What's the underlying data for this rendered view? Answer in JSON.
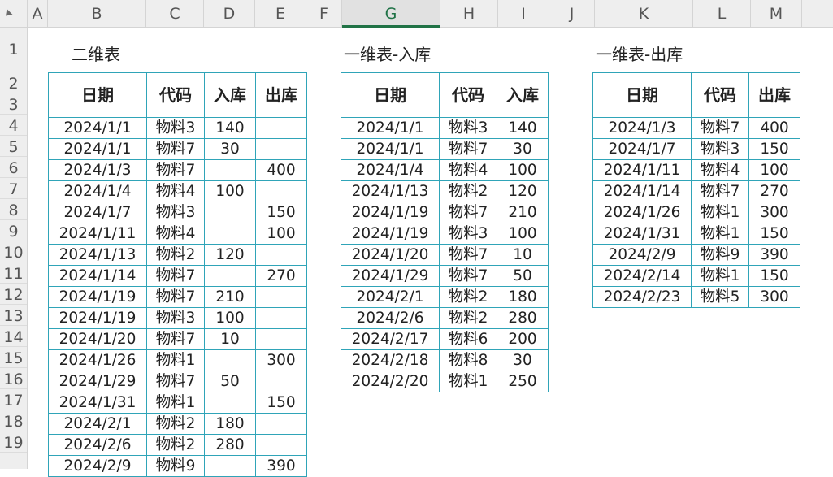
{
  "columns": [
    "A",
    "B",
    "C",
    "D",
    "E",
    "F",
    "G",
    "H",
    "I",
    "J",
    "K",
    "L",
    "M"
  ],
  "active_column": "G",
  "rows": [
    "1",
    "2",
    "3",
    "4",
    "5",
    "6",
    "7",
    "8",
    "9",
    "10",
    "11",
    "12",
    "13",
    "14",
    "15",
    "16",
    "17",
    "18",
    "19"
  ],
  "titles": {
    "two_dim": "二维表",
    "one_dim_in": "一维表-入库",
    "one_dim_out": "一维表-出库"
  },
  "table_b": {
    "headers": [
      "日期",
      "代码",
      "入库",
      "出库"
    ],
    "rows": [
      [
        "2024/1/1",
        "物料3",
        "140",
        ""
      ],
      [
        "2024/1/1",
        "物料7",
        "30",
        ""
      ],
      [
        "2024/1/3",
        "物料7",
        "",
        "400"
      ],
      [
        "2024/1/4",
        "物料4",
        "100",
        ""
      ],
      [
        "2024/1/7",
        "物料3",
        "",
        "150"
      ],
      [
        "2024/1/11",
        "物料4",
        "",
        "100"
      ],
      [
        "2024/1/13",
        "物料2",
        "120",
        ""
      ],
      [
        "2024/1/14",
        "物料7",
        "",
        "270"
      ],
      [
        "2024/1/19",
        "物料7",
        "210",
        ""
      ],
      [
        "2024/1/19",
        "物料3",
        "100",
        ""
      ],
      [
        "2024/1/20",
        "物料7",
        "10",
        ""
      ],
      [
        "2024/1/26",
        "物料1",
        "",
        "300"
      ],
      [
        "2024/1/29",
        "物料7",
        "50",
        ""
      ],
      [
        "2024/1/31",
        "物料1",
        "",
        "150"
      ],
      [
        "2024/2/1",
        "物料2",
        "180",
        ""
      ],
      [
        "2024/2/6",
        "物料2",
        "280",
        ""
      ],
      [
        "2024/2/9",
        "物料9",
        "",
        "390"
      ]
    ]
  },
  "table_g": {
    "headers": [
      "日期",
      "代码",
      "入库"
    ],
    "rows": [
      [
        "2024/1/1",
        "物料3",
        "140"
      ],
      [
        "2024/1/1",
        "物料7",
        "30"
      ],
      [
        "2024/1/4",
        "物料4",
        "100"
      ],
      [
        "2024/1/13",
        "物料2",
        "120"
      ],
      [
        "2024/1/19",
        "物料7",
        "210"
      ],
      [
        "2024/1/19",
        "物料3",
        "100"
      ],
      [
        "2024/1/20",
        "物料7",
        "10"
      ],
      [
        "2024/1/29",
        "物料7",
        "50"
      ],
      [
        "2024/2/1",
        "物料2",
        "180"
      ],
      [
        "2024/2/6",
        "物料2",
        "280"
      ],
      [
        "2024/2/17",
        "物料6",
        "200"
      ],
      [
        "2024/2/18",
        "物料8",
        "30"
      ],
      [
        "2024/2/20",
        "物料1",
        "250"
      ]
    ]
  },
  "table_k": {
    "headers": [
      "日期",
      "代码",
      "出库"
    ],
    "rows": [
      [
        "2024/1/3",
        "物料7",
        "400"
      ],
      [
        "2024/1/7",
        "物料3",
        "150"
      ],
      [
        "2024/1/11",
        "物料4",
        "100"
      ],
      [
        "2024/1/14",
        "物料7",
        "270"
      ],
      [
        "2024/1/26",
        "物料1",
        "300"
      ],
      [
        "2024/1/31",
        "物料1",
        "150"
      ],
      [
        "2024/2/9",
        "物料9",
        "390"
      ],
      [
        "2024/2/14",
        "物料1",
        "150"
      ],
      [
        "2024/2/23",
        "物料5",
        "300"
      ]
    ]
  }
}
